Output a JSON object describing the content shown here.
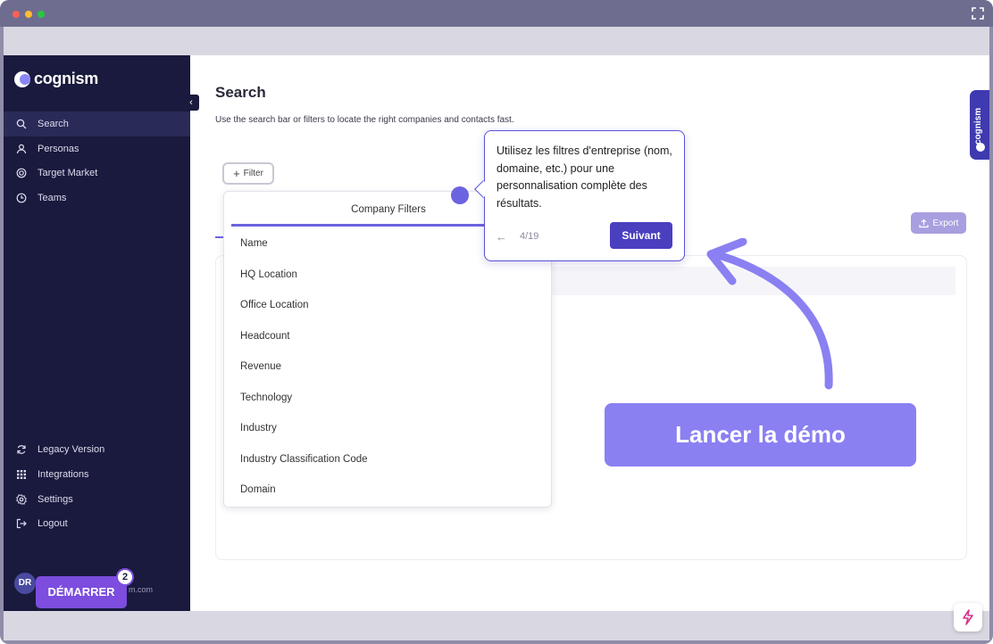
{
  "sidebar": {
    "brand": "cognism",
    "nav_top": [
      {
        "label": "Search",
        "icon": "search-icon",
        "active": true
      },
      {
        "label": "Personas",
        "icon": "person-icon"
      },
      {
        "label": "Target Market",
        "icon": "target-icon"
      },
      {
        "label": "Teams",
        "icon": "teams-icon"
      }
    ],
    "nav_bottom": [
      {
        "label": "Legacy Version",
        "icon": "refresh-icon"
      },
      {
        "label": "Integrations",
        "icon": "grid-icon"
      },
      {
        "label": "Settings",
        "icon": "gear-icon"
      },
      {
        "label": "Logout",
        "icon": "logout-icon"
      }
    ],
    "user": {
      "initials": "DR",
      "email_suffix": "m.com"
    }
  },
  "main": {
    "title": "Search",
    "subtitle": "Use the search bar or filters to locate the right companies and contacts fast.",
    "filter_label": "Filter",
    "export_label": "Export"
  },
  "dropdown": {
    "title": "Company Filters",
    "options": [
      "Name",
      "HQ Location",
      "Office Location",
      "Headcount",
      "Revenue",
      "Technology",
      "Industry",
      "Industry Classification Code",
      "Domain"
    ]
  },
  "tooltip": {
    "text": "Utilisez les filtres d'entreprise (nom, domaine, etc.) pour une personnalisation complète des résultats.",
    "step": "4/19",
    "next_label": "Suivant"
  },
  "demo": {
    "launch_label": "Lancer la démo",
    "start_label": "DÉMARRER",
    "start_badge": "2"
  },
  "side_widget": {
    "label": "cognism"
  },
  "colors": {
    "sidebar_bg": "#1a1a3e",
    "accent": "#6c63e0",
    "tooltip_button": "#4a3fbf",
    "launch_button": "#8a80f2",
    "start_button": "#7c4dde"
  }
}
